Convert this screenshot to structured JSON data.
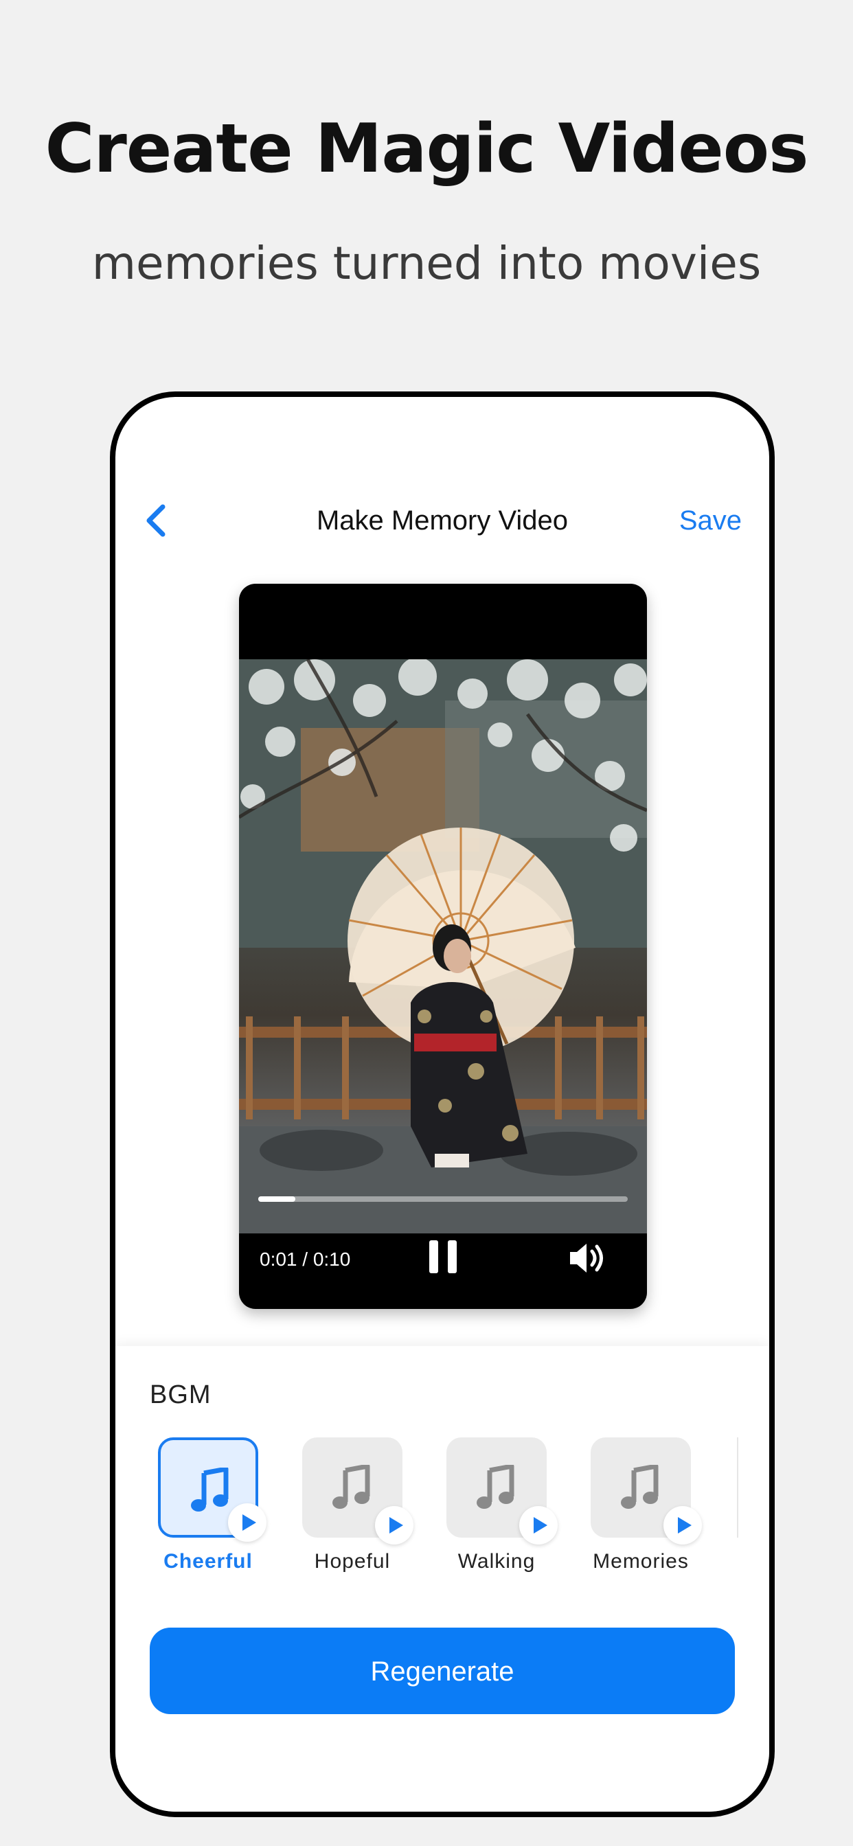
{
  "marketing": {
    "headline": "Create Magic Videos",
    "subhead": "memories turned into movies"
  },
  "nav": {
    "back_icon": "chevron-left-icon",
    "title": "Make Memory Video",
    "save_label": "Save"
  },
  "player": {
    "time": "0:01 / 0:10",
    "progress": 0.1,
    "pause_icon": "pause-icon",
    "volume_icon": "speaker-volume-icon"
  },
  "bgm": {
    "label": "BGM",
    "selected": "Cheerful",
    "tracks": [
      {
        "name": "Cheerful"
      },
      {
        "name": "Hopeful"
      },
      {
        "name": "Walking"
      },
      {
        "name": "Memories"
      }
    ]
  },
  "actions": {
    "regenerate_label": "Regenerate"
  },
  "colors": {
    "accent": "#1a7cf0",
    "button": "#0b7cf6",
    "background": "#f1f1f1"
  }
}
